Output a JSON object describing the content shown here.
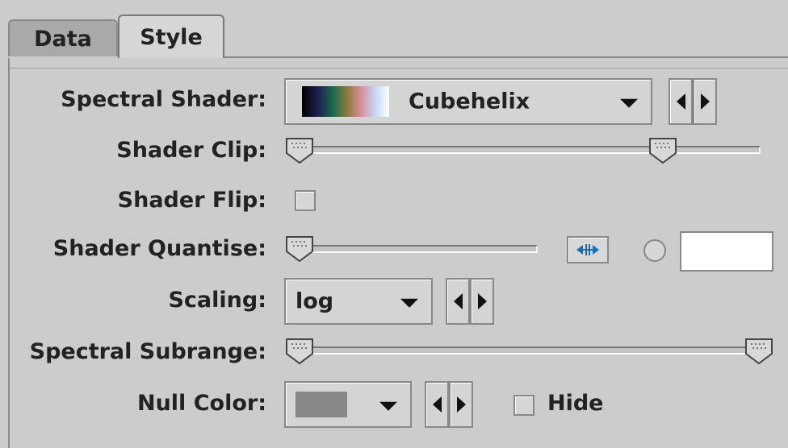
{
  "tabs": [
    {
      "label": "Data",
      "selected": false
    },
    {
      "label": "Style",
      "selected": true
    }
  ],
  "rows": {
    "spectral_shader": {
      "label": "Spectral Shader:",
      "value": "Cubehelix",
      "swatch_colors": [
        "#000000",
        "#1c1e50",
        "#1a6b4c",
        "#8e7a3c",
        "#d88ca0",
        "#c2d8f4",
        "#ffffff"
      ]
    },
    "shader_clip": {
      "label": "Shader Clip:",
      "low": 0.0,
      "high": 0.8
    },
    "shader_flip": {
      "label": "Shader Flip:",
      "checked": false
    },
    "shader_quantise": {
      "label": "Shader Quantise:",
      "value": 0.0,
      "radio_selected": false,
      "text_value": ""
    },
    "scaling": {
      "label": "Scaling:",
      "value": "log"
    },
    "spectral_subrange": {
      "label": "Spectral Subrange:",
      "low": 0.0,
      "high": 1.0
    },
    "null_color": {
      "label": "Null Color:",
      "swatch_color": "#888888",
      "hide_label": "Hide",
      "hide_checked": false
    }
  },
  "colors": {
    "background": "#cccccc",
    "selected_tab": "#d6d6d6",
    "unselected_tab": "#a9a9a9",
    "icon_blue": "#1a6fb0"
  }
}
